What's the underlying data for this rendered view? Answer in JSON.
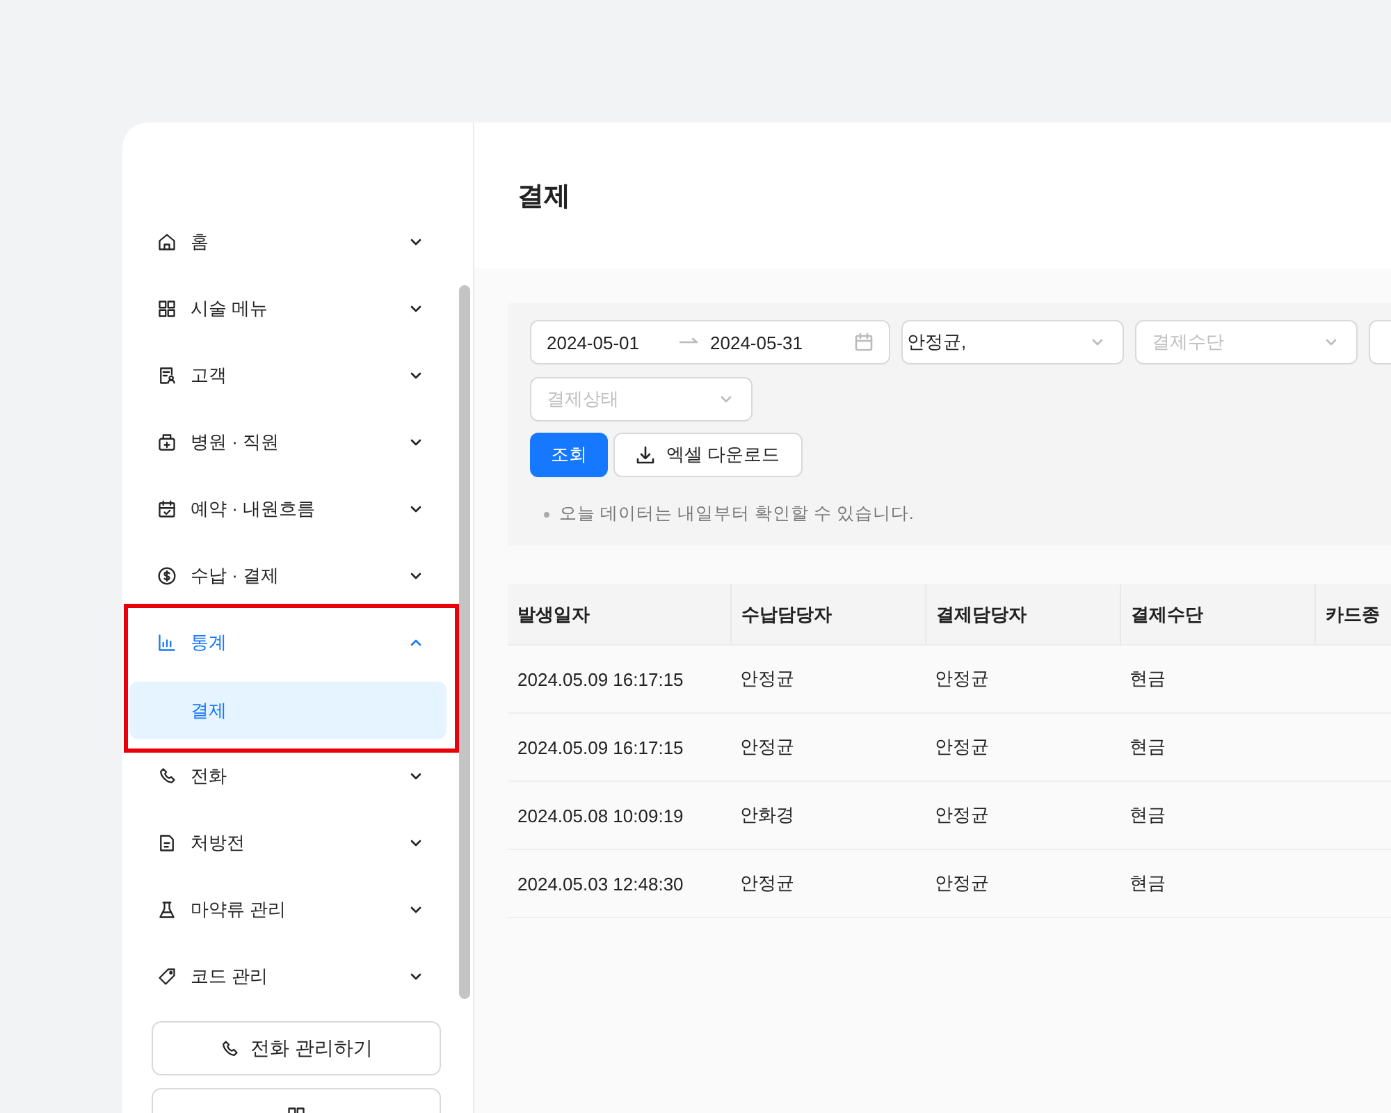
{
  "sidebar": {
    "items": [
      {
        "label": "홈",
        "kind": "home",
        "expanded": false,
        "highlighted": false
      },
      {
        "label": "시술 메뉴",
        "kind": "grid",
        "expanded": false,
        "highlighted": false
      },
      {
        "label": "고객",
        "kind": "customer",
        "expanded": false,
        "highlighted": false
      },
      {
        "label": "병원 · 직원",
        "kind": "hospital",
        "expanded": false,
        "highlighted": false
      },
      {
        "label": "예약 · 내원흐름",
        "kind": "calendar",
        "expanded": false,
        "highlighted": false
      },
      {
        "label": "수납 · 결제",
        "kind": "dollar",
        "expanded": false,
        "highlighted": false
      },
      {
        "label": "통계",
        "kind": "chart",
        "expanded": true,
        "highlighted": true,
        "children": [
          {
            "label": "결제",
            "selected": true
          }
        ]
      },
      {
        "label": "전화",
        "kind": "phone",
        "expanded": false,
        "highlighted": false
      },
      {
        "label": "처방전",
        "kind": "file",
        "expanded": false,
        "highlighted": false
      },
      {
        "label": "마약류 관리",
        "kind": "flask",
        "expanded": false,
        "highlighted": false
      },
      {
        "label": "코드 관리",
        "kind": "tag",
        "expanded": false,
        "highlighted": false
      }
    ],
    "buttons": [
      {
        "label": "전화 관리하기",
        "kind": "phone"
      },
      {
        "kind": "qr"
      }
    ]
  },
  "page": {
    "title": "결제"
  },
  "filters": [
    {
      "kind": "daterange",
      "start": "2024-05-01",
      "end": "2024-05-31"
    },
    {
      "kind": "select",
      "value": "안정균,"
    },
    {
      "kind": "select",
      "placeholder": "결제수단"
    },
    {
      "kind": "select"
    },
    {
      "kind": "select",
      "placeholder": "결제상태"
    }
  ],
  "actions": [
    {
      "label": "조회",
      "kind": "primary"
    },
    {
      "label": "엑셀 다운로드",
      "kind": "download"
    }
  ],
  "note": "오늘 데이터는 내일부터 확인할 수 있습니다.",
  "table": {
    "columns": [
      "발생일자",
      "수납담당자",
      "결제담당자",
      "결제수단",
      "카드종"
    ],
    "rows": [
      [
        "2024.05.09 16:17:15",
        "안정균",
        "안정균",
        "현금"
      ],
      [
        "2024.05.09 16:17:15",
        "안정균",
        "안정균",
        "현금"
      ],
      [
        "2024.05.08 10:09:19",
        "안화경",
        "안정균",
        "현금"
      ],
      [
        "2024.05.03 12:48:30",
        "안정균",
        "안정균",
        "현금"
      ]
    ]
  }
}
